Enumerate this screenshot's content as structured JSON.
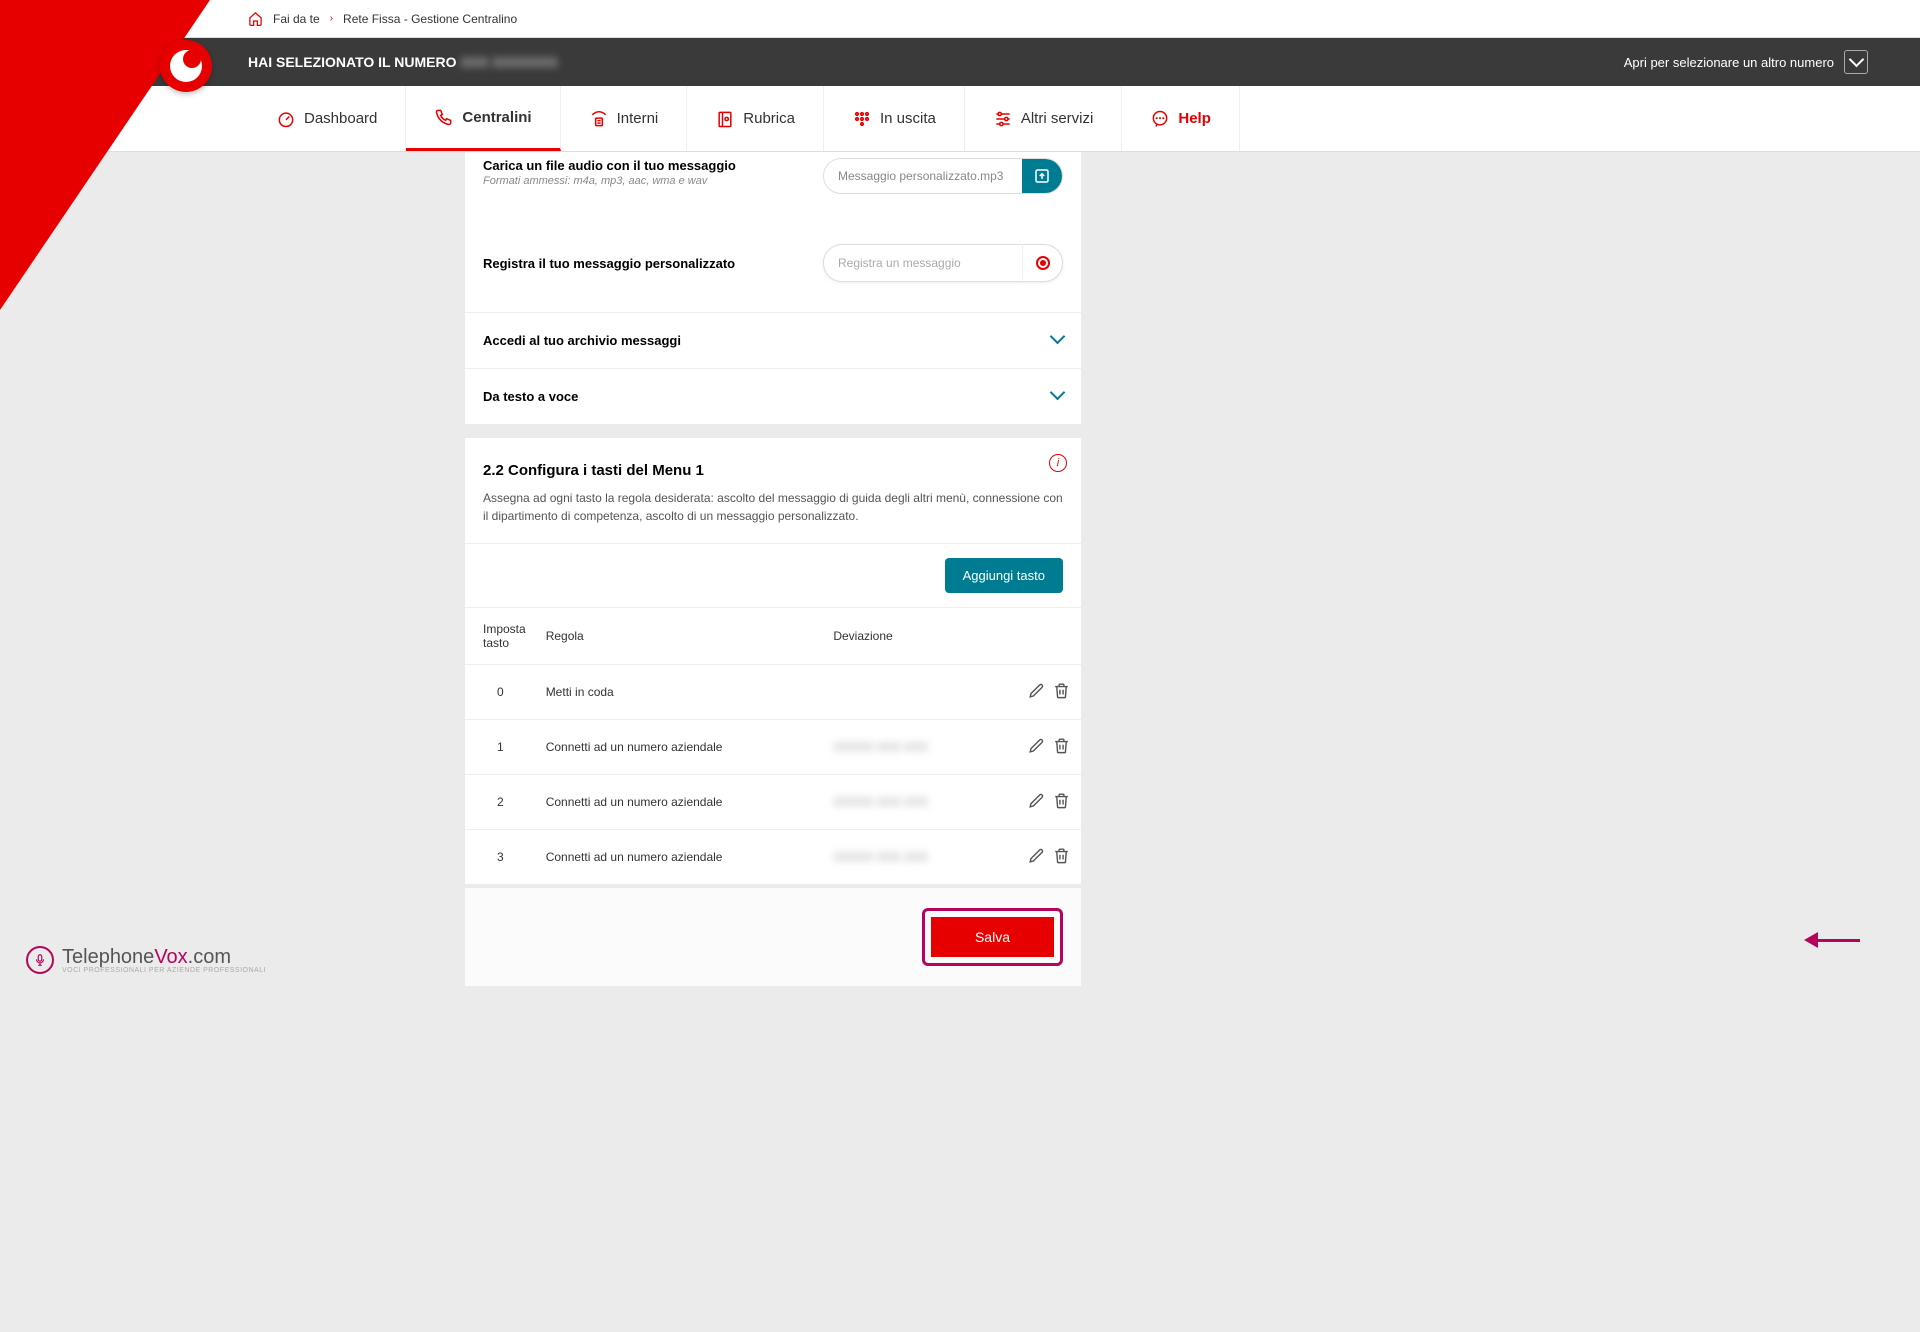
{
  "breadcrumb": {
    "home": "Fai da te",
    "page": "Rete Fissa - Gestione Centralino"
  },
  "selector": {
    "prefix": "HAI SELEZIONATO IL NUMERO",
    "number": "XXX XXXXXXX",
    "switch": "Apri per selezionare un altro numero"
  },
  "nav": {
    "items": [
      {
        "label": "Dashboard"
      },
      {
        "label": "Centralini"
      },
      {
        "label": "Interni"
      },
      {
        "label": "Rubrica"
      },
      {
        "label": "In uscita"
      },
      {
        "label": "Altri servizi"
      },
      {
        "label": "Help"
      }
    ]
  },
  "upload": {
    "label": "Carica un file audio con il tuo messaggio",
    "sub": "Formati ammessi: m4a, mp3, aac, wma e wav",
    "filename": "Messaggio personalizzato.mp3"
  },
  "record": {
    "label": "Registra il tuo messaggio personalizzato",
    "placeholder": "Registra un messaggio"
  },
  "expand": {
    "archive": "Accedi al tuo archivio messaggi",
    "tts": "Da testo a voce"
  },
  "section": {
    "title": "2.2 Configura i tasti del Menu 1",
    "desc": "Assegna ad ogni tasto la regola desiderata: ascolto del messaggio di guida degli altri menù, connessione con il dipartimento di competenza, ascolto di un messaggio personalizzato."
  },
  "addButton": "Aggiungi tasto",
  "table": {
    "headers": {
      "key": "Imposta tasto",
      "rule": "Regola",
      "dev": "Deviazione"
    },
    "rows": [
      {
        "key": "0",
        "rule": "Metti in coda",
        "dev": ""
      },
      {
        "key": "1",
        "rule": "Connetti ad un numero aziendale",
        "dev": "XXXXX XXX XXX"
      },
      {
        "key": "2",
        "rule": "Connetti ad un numero aziendale",
        "dev": "XXXXX XXX XXX"
      },
      {
        "key": "3",
        "rule": "Connetti ad un numero aziendale",
        "dev": "XXXXX XXX XXX"
      }
    ]
  },
  "save": "Salva",
  "watermark": {
    "brand": "Telephone",
    "suffix": "Vox",
    "tld": ".com",
    "tagline": "VOCI PROFESSIONALI PER AZIENDE PROFESSIONALI"
  }
}
